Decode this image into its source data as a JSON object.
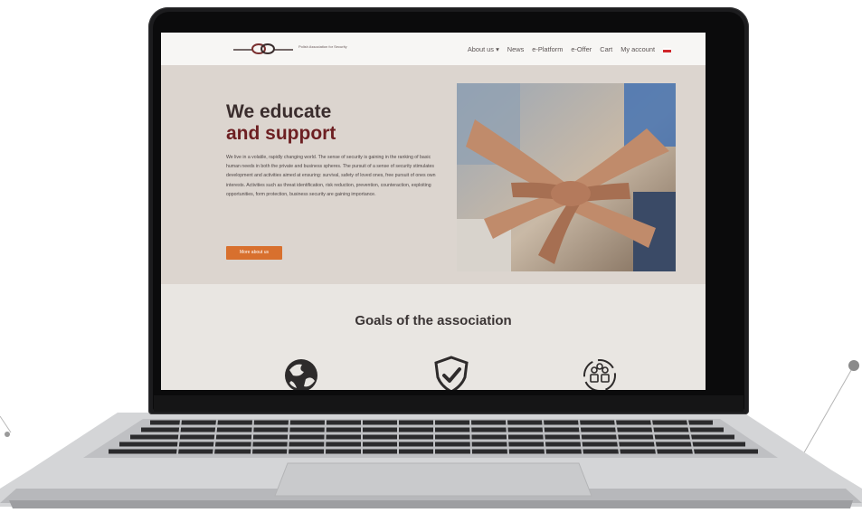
{
  "nav": {
    "logo_text": "Polish Association for Security",
    "menu": [
      "About us",
      "News",
      "e-Platform",
      "e-Offer",
      "Cart",
      "My account"
    ],
    "about_caret": "▾"
  },
  "hero": {
    "title_line1": "We educate",
    "title_line2": "and support",
    "paragraph": "We live in a volatile, rapidly changing world. The sense of security is gaining in the ranking of basic human needs in both the private and business spheres. The pursuit of a sense of security stimulates development and activities aimed at ensuring: survival, safety of loved ones, free pursuit of ones own interests. Activities such as threat identification, risk reduction, prevention, counteraction, exploiting opportunities, form protection, business security are gaining importance.",
    "button_label": "More about us",
    "image_alt": "stacked-hands-photo"
  },
  "goals": {
    "title": "Goals of the association",
    "icons": [
      "globe-icon",
      "shield-check-icon",
      "people-cycle-icon"
    ]
  },
  "colors": {
    "accent": "#d8702e",
    "title_dark": "#3a2d2d",
    "title_red": "#6d1f22",
    "hero_bg": "#dcd5cf"
  }
}
